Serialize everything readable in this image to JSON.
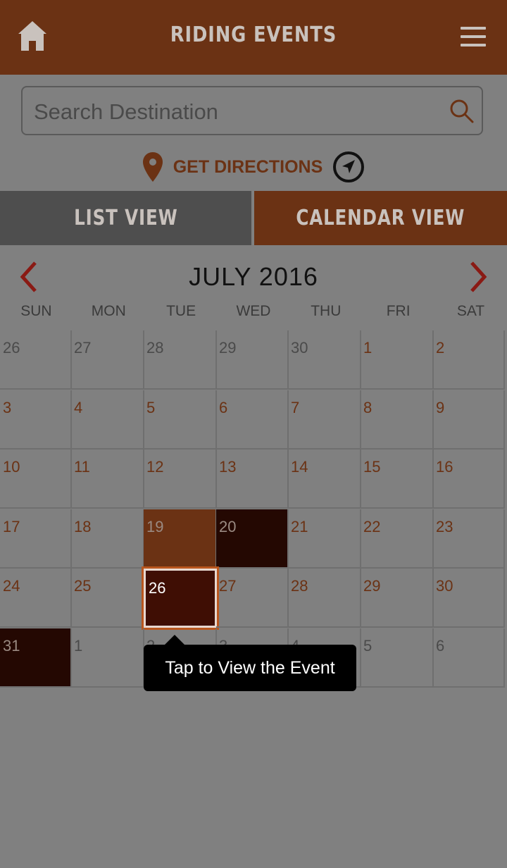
{
  "header": {
    "title": "RIDING EVENTS",
    "home_icon": "home-icon",
    "menu_icon": "hamburger-menu-icon"
  },
  "search": {
    "placeholder": "Search Destination",
    "value": ""
  },
  "directions": {
    "label": "GET DIRECTIONS"
  },
  "tabs": {
    "list": "LIST VIEW",
    "calendar": "CALENDAR VIEW",
    "active": "calendar"
  },
  "calendar": {
    "month": "JULY 2016",
    "days_of_week": [
      "SUN",
      "MON",
      "TUE",
      "WED",
      "THU",
      "FRI",
      "SAT"
    ],
    "weeks": [
      [
        "26",
        "27",
        "28",
        "29",
        "30",
        "1",
        "2"
      ],
      [
        "3",
        "4",
        "5",
        "6",
        "7",
        "8",
        "9"
      ],
      [
        "10",
        "11",
        "12",
        "13",
        "14",
        "15",
        "16"
      ],
      [
        "17",
        "18",
        "19",
        "20",
        "21",
        "22",
        "23"
      ],
      [
        "24",
        "25",
        "26",
        "27",
        "28",
        "29",
        "30"
      ],
      [
        "31",
        "1",
        "2",
        "3",
        "4",
        "5",
        "6"
      ]
    ],
    "selected_day": "26"
  },
  "tooltip": {
    "text": "Tap to View the Event"
  },
  "colors": {
    "brand": "#6b3214",
    "event_dark": "#240802",
    "selected": "#3f0e04",
    "overlay": "#808080"
  }
}
